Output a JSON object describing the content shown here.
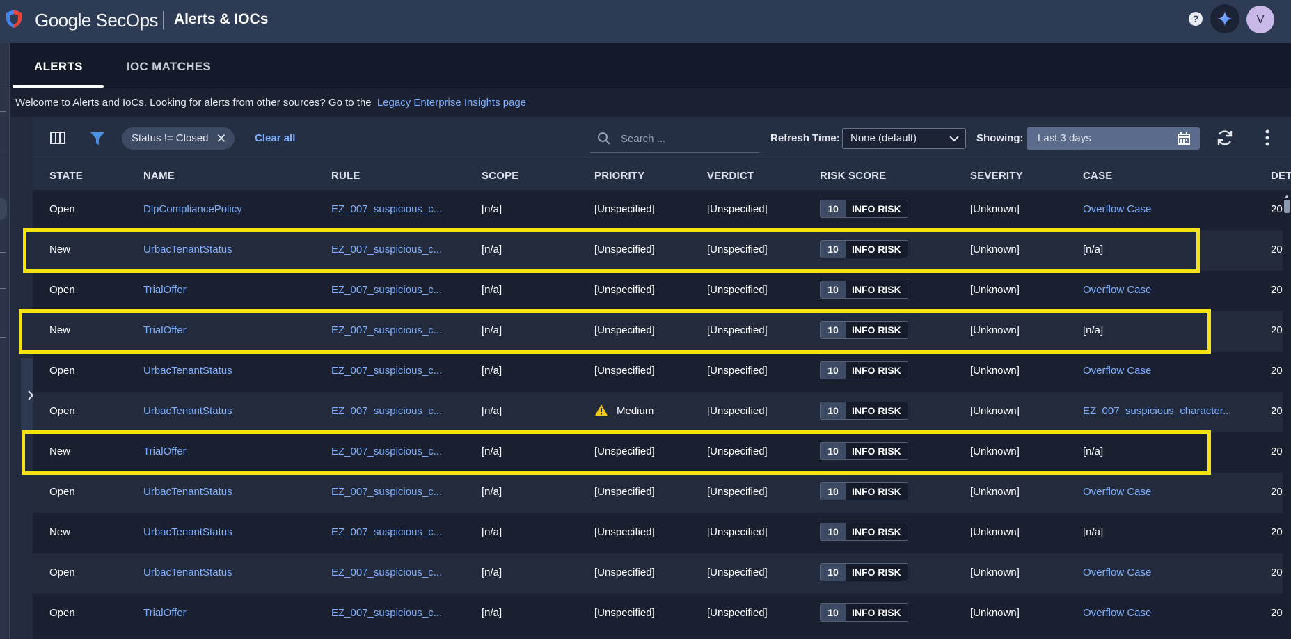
{
  "header": {
    "brand": "Google SecOps",
    "title": "Alerts & IOCs",
    "help_label": "?",
    "avatar_initial": "V"
  },
  "tabs": [
    {
      "label": "ALERTS",
      "active": true
    },
    {
      "label": "IOC MATCHES",
      "active": false
    }
  ],
  "welcome": {
    "text": "Welcome to Alerts and IoCs. Looking for alerts from other sources? Go to the",
    "link": "Legacy Enterprise Insights page"
  },
  "toolbar": {
    "filter_chip": "Status != Closed",
    "clear_all": "Clear all",
    "search_placeholder": "Search ...",
    "refresh_label": "Refresh Time:",
    "refresh_value": "None (default)",
    "showing_label": "Showing:",
    "showing_value": "Last 3 days"
  },
  "columns": [
    "STATE",
    "NAME",
    "RULE",
    "SCOPE",
    "PRIORITY",
    "VERDICT",
    "RISK SCORE",
    "SEVERITY",
    "CASE",
    "DET"
  ],
  "rows": [
    {
      "state": "Open",
      "name": "DlpCompliancePolicy",
      "rule": "EZ_007_suspicious_c...",
      "scope": "[n/a]",
      "priority": "[Unspecified]",
      "priority_icon": "",
      "verdict": "[Unspecified]",
      "risk_score": "10",
      "risk_label": "INFO RISK",
      "severity": "[Unknown]",
      "case": "Overflow Case",
      "case_is_link": true,
      "det": "20"
    },
    {
      "state": "New",
      "name": "UrbacTenantStatus",
      "rule": "EZ_007_suspicious_c...",
      "scope": "[n/a]",
      "priority": "[Unspecified]",
      "priority_icon": "",
      "verdict": "[Unspecified]",
      "risk_score": "10",
      "risk_label": "INFO RISK",
      "severity": "[Unknown]",
      "case": "[n/a]",
      "case_is_link": false,
      "det": "20"
    },
    {
      "state": "Open",
      "name": "TrialOffer",
      "rule": "EZ_007_suspicious_c...",
      "scope": "[n/a]",
      "priority": "[Unspecified]",
      "priority_icon": "",
      "verdict": "[Unspecified]",
      "risk_score": "10",
      "risk_label": "INFO RISK",
      "severity": "[Unknown]",
      "case": "Overflow Case",
      "case_is_link": true,
      "det": "20"
    },
    {
      "state": "New",
      "name": "TrialOffer",
      "rule": "EZ_007_suspicious_c...",
      "scope": "[n/a]",
      "priority": "[Unspecified]",
      "priority_icon": "",
      "verdict": "[Unspecified]",
      "risk_score": "10",
      "risk_label": "INFO RISK",
      "severity": "[Unknown]",
      "case": "[n/a]",
      "case_is_link": false,
      "det": "20"
    },
    {
      "state": "Open",
      "name": "UrbacTenantStatus",
      "rule": "EZ_007_suspicious_c...",
      "scope": "[n/a]",
      "priority": "[Unspecified]",
      "priority_icon": "",
      "verdict": "[Unspecified]",
      "risk_score": "10",
      "risk_label": "INFO RISK",
      "severity": "[Unknown]",
      "case": "Overflow Case",
      "case_is_link": true,
      "det": "20"
    },
    {
      "state": "Open",
      "name": "UrbacTenantStatus",
      "rule": "EZ_007_suspicious_c...",
      "scope": "[n/a]",
      "priority": "Medium",
      "priority_icon": "warning-icon",
      "verdict": "[Unspecified]",
      "risk_score": "10",
      "risk_label": "INFO RISK",
      "severity": "[Unknown]",
      "case": "EZ_007_suspicious_character...",
      "case_is_link": true,
      "det": "20"
    },
    {
      "state": "New",
      "name": "TrialOffer",
      "rule": "EZ_007_suspicious_c...",
      "scope": "[n/a]",
      "priority": "[Unspecified]",
      "priority_icon": "",
      "verdict": "[Unspecified]",
      "risk_score": "10",
      "risk_label": "INFO RISK",
      "severity": "[Unknown]",
      "case": "[n/a]",
      "case_is_link": false,
      "det": "20"
    },
    {
      "state": "Open",
      "name": "UrbacTenantStatus",
      "rule": "EZ_007_suspicious_c...",
      "scope": "[n/a]",
      "priority": "[Unspecified]",
      "priority_icon": "",
      "verdict": "[Unspecified]",
      "risk_score": "10",
      "risk_label": "INFO RISK",
      "severity": "[Unknown]",
      "case": "Overflow Case",
      "case_is_link": true,
      "det": "20"
    },
    {
      "state": "New",
      "name": "UrbacTenantStatus",
      "rule": "EZ_007_suspicious_c...",
      "scope": "[n/a]",
      "priority": "[Unspecified]",
      "priority_icon": "",
      "verdict": "[Unspecified]",
      "risk_score": "10",
      "risk_label": "INFO RISK",
      "severity": "[Unknown]",
      "case": "[n/a]",
      "case_is_link": false,
      "det": "20"
    },
    {
      "state": "Open",
      "name": "UrbacTenantStatus",
      "rule": "EZ_007_suspicious_c...",
      "scope": "[n/a]",
      "priority": "[Unspecified]",
      "priority_icon": "",
      "verdict": "[Unspecified]",
      "risk_score": "10",
      "risk_label": "INFO RISK",
      "severity": "[Unknown]",
      "case": "Overflow Case",
      "case_is_link": true,
      "det": "20"
    },
    {
      "state": "Open",
      "name": "TrialOffer",
      "rule": "EZ_007_suspicious_c...",
      "scope": "[n/a]",
      "priority": "[Unspecified]",
      "priority_icon": "",
      "verdict": "[Unspecified]",
      "risk_score": "10",
      "risk_label": "INFO RISK",
      "severity": "[Unknown]",
      "case": "Overflow Case",
      "case_is_link": true,
      "det": "20"
    }
  ],
  "highlighted_rows": [
    1,
    3,
    6
  ],
  "colors": {
    "header_bg": "#2e3b55",
    "link": "#7fb0ff",
    "highlight": "#f7e20f",
    "warning": "#f5c518"
  }
}
